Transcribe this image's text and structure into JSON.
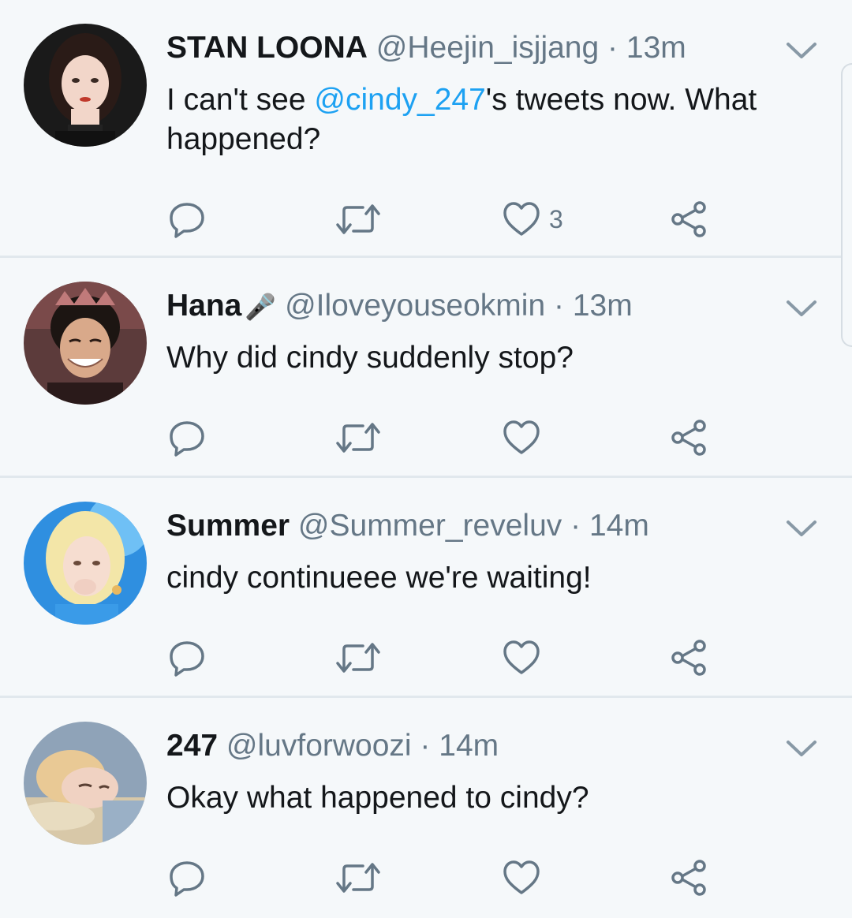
{
  "tweets": [
    {
      "name": "STAN LOONA",
      "handle": "@Heejin_isjjang",
      "time": "13m",
      "text_before": "I can't see ",
      "mention": "@cindy_247",
      "text_after": "'s tweets now. What happened?",
      "likes": "3",
      "avatar": {
        "bg": "#1a1a1a",
        "skin": "#f2d6c9",
        "hair": "#2a1b17"
      }
    },
    {
      "name": "Hana",
      "name_suffix": "🎤",
      "handle": "@Iloveyouseokmin",
      "time": "13m",
      "text_before": "Why did cindy suddenly stop?",
      "mention": "",
      "text_after": "",
      "likes": "",
      "avatar": {
        "bg": "#5c3b3b",
        "skin": "#d9a98a",
        "hair": "#1c1512"
      }
    },
    {
      "name": "Summer",
      "handle": "@Summer_reveluv",
      "time": "14m",
      "text_before": "cindy continueee we're waiting!",
      "mention": "",
      "text_after": "",
      "likes": "",
      "avatar": {
        "bg": "#2f8fe0",
        "skin": "#f6ddd0",
        "hair": "#f3e6a8"
      }
    },
    {
      "name": "247",
      "handle": "@luvforwoozi",
      "time": "14m",
      "text_before": "Okay what happened to cindy?",
      "mention": "",
      "text_after": "",
      "likes": "",
      "avatar": {
        "bg": "#8fa3b8",
        "skin": "#f0d2c2",
        "hair": "#e9c995"
      }
    }
  ],
  "separator": " · ",
  "colors": {
    "background": "#f5f8fa",
    "text": "#14171a",
    "secondary": "#657786",
    "link": "#1da1f2",
    "border": "#e1e8ed"
  },
  "icons": [
    "reply-icon",
    "retweet-icon",
    "like-icon",
    "share-icon",
    "chevron-down-icon",
    "microphone-icon"
  ]
}
